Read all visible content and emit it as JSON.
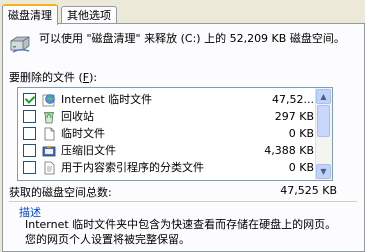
{
  "tabs": [
    {
      "label": "磁盘清理",
      "active": true
    },
    {
      "label": "其他选项",
      "active": false
    }
  ],
  "description": "可以使用 \"磁盘清理\" 来释放 (C:) 上的 52,209 KB 磁盘空间。",
  "files_to_delete_label": "要删除的文件 (",
  "files_to_delete_hotkey": "F",
  "files_to_delete_suffix": "):",
  "file_list": [
    {
      "name": "Internet 临时文件",
      "size": "47,52...",
      "checked": true,
      "icon": "globe-icon"
    },
    {
      "name": "回收站",
      "size": "297 KB",
      "checked": false,
      "icon": "recycle-bin-icon"
    },
    {
      "name": "临时文件",
      "size": "0 KB",
      "checked": false,
      "icon": "temp-file-icon"
    },
    {
      "name": "压缩旧文件",
      "size": "4,388 KB",
      "checked": false,
      "icon": "compress-icon"
    },
    {
      "name": "用于内容索引程序的分类文件",
      "size": "0 KB",
      "checked": false,
      "icon": "catalog-file-icon"
    }
  ],
  "space_gained_label": "获取的磁盘空间总数:",
  "space_gained_value": "47,525 KB",
  "description_group_title": "描述",
  "description_text": "Internet 临时文件夹中包含为快速查看而存储在硬盘上的网页。您的网页个人设置将被完整保留。"
}
